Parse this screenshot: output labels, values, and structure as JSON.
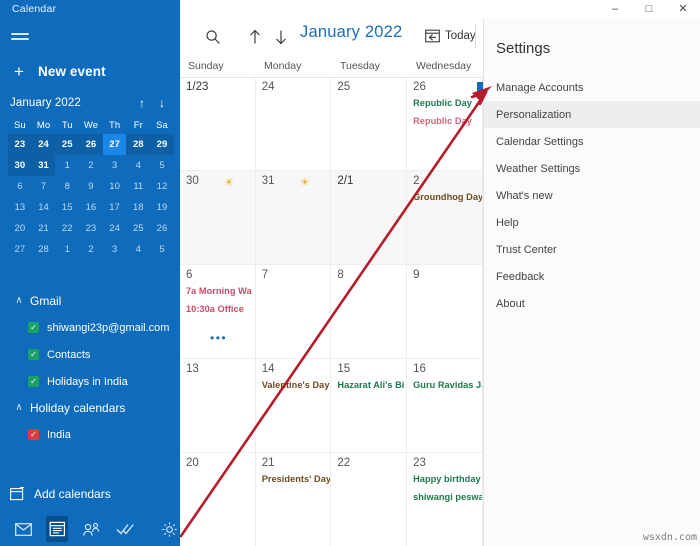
{
  "window": {
    "app_title": "Calendar",
    "controls": [
      {
        "name": "minimize",
        "glyph": "–"
      },
      {
        "name": "maximize",
        "glyph": "□"
      },
      {
        "name": "close",
        "glyph": "✕"
      }
    ]
  },
  "sidebar": {
    "hamburger_label": "Menu",
    "new_event": {
      "icon": "plus-icon",
      "label": "New event"
    },
    "mini_calendar": {
      "title": "January 2022",
      "prev_icon": "arrow-up-icon",
      "next_icon": "arrow-down-icon",
      "day_headers": [
        "Su",
        "Mo",
        "Tu",
        "We",
        "Th",
        "Fr",
        "Sa"
      ],
      "weeks": [
        [
          {
            "n": "23",
            "cur": true,
            "week": true
          },
          {
            "n": "24",
            "cur": true,
            "week": true
          },
          {
            "n": "25",
            "cur": true,
            "week": true
          },
          {
            "n": "26",
            "cur": true,
            "week": true
          },
          {
            "n": "27",
            "cur": true,
            "week": true,
            "today": true
          },
          {
            "n": "28",
            "cur": true,
            "week": true
          },
          {
            "n": "29",
            "cur": true,
            "week": true
          }
        ],
        [
          {
            "n": "30",
            "cur": true,
            "week": true
          },
          {
            "n": "31",
            "cur": true,
            "week": true
          },
          {
            "n": "1",
            "cur": false
          },
          {
            "n": "2",
            "cur": false
          },
          {
            "n": "3",
            "cur": false
          },
          {
            "n": "4",
            "cur": false
          },
          {
            "n": "5",
            "cur": false
          }
        ],
        [
          {
            "n": "6",
            "cur": false
          },
          {
            "n": "7",
            "cur": false
          },
          {
            "n": "8",
            "cur": false
          },
          {
            "n": "9",
            "cur": false
          },
          {
            "n": "10",
            "cur": false
          },
          {
            "n": "11",
            "cur": false
          },
          {
            "n": "12",
            "cur": false
          }
        ],
        [
          {
            "n": "13",
            "cur": false
          },
          {
            "n": "14",
            "cur": false
          },
          {
            "n": "15",
            "cur": false
          },
          {
            "n": "16",
            "cur": false
          },
          {
            "n": "17",
            "cur": false
          },
          {
            "n": "18",
            "cur": false
          },
          {
            "n": "19",
            "cur": false
          }
        ],
        [
          {
            "n": "20",
            "cur": false
          },
          {
            "n": "21",
            "cur": false
          },
          {
            "n": "22",
            "cur": false
          },
          {
            "n": "23",
            "cur": false
          },
          {
            "n": "24",
            "cur": false
          },
          {
            "n": "25",
            "cur": false
          },
          {
            "n": "26",
            "cur": false
          }
        ],
        [
          {
            "n": "27",
            "cur": false
          },
          {
            "n": "28",
            "cur": false
          },
          {
            "n": "1",
            "cur": false
          },
          {
            "n": "2",
            "cur": false
          },
          {
            "n": "3",
            "cur": false
          },
          {
            "n": "4",
            "cur": false
          },
          {
            "n": "5",
            "cur": false
          }
        ]
      ]
    },
    "groups": [
      {
        "label": "Gmail",
        "expanded": true,
        "items": [
          {
            "label": "shiwangi23p@gmail.com",
            "checked": true,
            "color": "#1aa260"
          },
          {
            "label": "Contacts",
            "checked": true,
            "color": "#1aa260"
          },
          {
            "label": "Holidays in India",
            "checked": true,
            "color": "#1aa260"
          }
        ]
      },
      {
        "label": "Holiday calendars",
        "expanded": true,
        "items": [
          {
            "label": "India",
            "checked": true,
            "color": "#e03b3b"
          }
        ]
      }
    ],
    "add_calendars": {
      "icon": "add-calendar-icon",
      "label": "Add calendars"
    },
    "bottom_bar": [
      {
        "name": "mail-icon",
        "selected": false
      },
      {
        "name": "calendar-icon",
        "selected": true
      },
      {
        "name": "people-icon",
        "selected": false
      },
      {
        "name": "todo-icon",
        "selected": false
      },
      {
        "name": "settings-gear-icon",
        "selected": false
      }
    ]
  },
  "calendar": {
    "toolbar": {
      "search_icon": "search-icon",
      "prev_icon": "arrow-up-icon",
      "next_icon": "arrow-down-icon",
      "month_label": "January 2022",
      "today_label": "Today",
      "today_icon": "today-calendar-icon"
    },
    "day_headers": [
      "Sunday",
      "Monday",
      "Tuesday",
      "Wednesday"
    ],
    "weeks": [
      {
        "shaded": false,
        "days": [
          {
            "num": "1/23",
            "events": []
          },
          {
            "num": "24",
            "events": []
          },
          {
            "num": "25",
            "events": []
          },
          {
            "num": "26",
            "events": [
              {
                "text": "Republic Day",
                "color": "green"
              },
              {
                "text": "Republic Day",
                "color": "red"
              }
            ]
          }
        ]
      },
      {
        "shaded": true,
        "days": [
          {
            "num": "30",
            "weather": "sun-icon",
            "events": []
          },
          {
            "num": "31",
            "weather": "sun-icon",
            "events": []
          },
          {
            "num": "2/1",
            "events": []
          },
          {
            "num": "2",
            "events": [
              {
                "text": "Groundhog Day",
                "color": "brown"
              }
            ]
          }
        ]
      },
      {
        "shaded": false,
        "days": [
          {
            "num": "6",
            "events": [
              {
                "text": "7a Morning Wa",
                "color": "redd"
              },
              {
                "text": "10:30a Office",
                "color": "redd"
              }
            ],
            "overflow": "•••"
          },
          {
            "num": "7",
            "events": []
          },
          {
            "num": "8",
            "events": []
          },
          {
            "num": "9",
            "events": []
          }
        ]
      },
      {
        "shaded": false,
        "days": [
          {
            "num": "13",
            "events": []
          },
          {
            "num": "14",
            "events": [
              {
                "text": "Valentine's Day",
                "color": "brown"
              }
            ]
          },
          {
            "num": "15",
            "events": [
              {
                "text": "Hazarat Ali's Bi",
                "color": "green"
              }
            ]
          },
          {
            "num": "16",
            "events": [
              {
                "text": "Guru Ravidas Ja",
                "color": "green"
              }
            ]
          }
        ]
      },
      {
        "shaded": false,
        "days": [
          {
            "num": "20",
            "events": []
          },
          {
            "num": "21",
            "events": [
              {
                "text": "Presidents' Day",
                "color": "brown"
              }
            ]
          },
          {
            "num": "22",
            "events": []
          },
          {
            "num": "23",
            "events": [
              {
                "text": "Happy birthday",
                "color": "green"
              },
              {
                "text": "shiwangi peswa",
                "color": "green"
              }
            ]
          }
        ]
      }
    ]
  },
  "settings": {
    "title": "Settings",
    "items": [
      {
        "label": "Manage Accounts",
        "active": false
      },
      {
        "label": "Personalization",
        "active": true
      },
      {
        "label": "Calendar Settings",
        "active": false
      },
      {
        "label": "Weather Settings",
        "active": false
      },
      {
        "label": "What's new",
        "active": false
      },
      {
        "label": "Help",
        "active": false
      },
      {
        "label": "Trust Center",
        "active": false
      },
      {
        "label": "Feedback",
        "active": false
      },
      {
        "label": "About",
        "active": false
      }
    ]
  },
  "annotation": {
    "arrow_color": "#b51d2a",
    "description": "red arrow from settings gear to Personalization"
  },
  "watermark": "wsxdn.com",
  "colors": {
    "sidebar_blue": "#0f6cbd",
    "accent_blue": "#1a6fb5",
    "today_blue": "#1a86e8",
    "event_green": "#1b7a4d",
    "event_red": "#c94a63",
    "event_brown": "#6b4a1e",
    "sun_gold": "#e8b029"
  }
}
